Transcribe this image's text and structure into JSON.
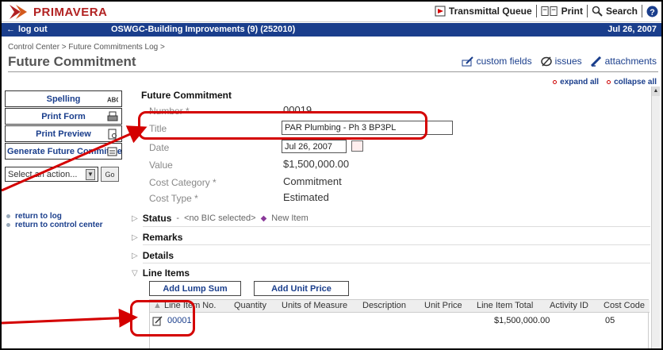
{
  "brand": {
    "name": "PRIMAVERA"
  },
  "toplinks": {
    "transmittal": "Transmittal Queue",
    "print": "Print",
    "search": "Search",
    "help": "?"
  },
  "navbar": {
    "logout": "log out",
    "project": "OSWGC-Building Improvements (9) (252010)",
    "date": "Jul 26, 2007"
  },
  "header": {
    "breadcrumb": "Control Center > Future Commitments Log >",
    "title": "Future Commitment",
    "actions": {
      "custom_fields": "custom fields",
      "issues": "issues",
      "attachments": "attachments"
    },
    "expand_all": "expand all",
    "collapse_all": "collapse all"
  },
  "sidebar": {
    "buttons": [
      "Spelling",
      "Print Form",
      "Print Preview",
      "Generate Future Commitme"
    ],
    "select_placeholder": "Select an action...",
    "go": "Go",
    "links": [
      "return to log",
      "return to control center"
    ]
  },
  "form": {
    "heading": "Future Commitment",
    "labels": {
      "number": "Number *",
      "title": "Title",
      "date": "Date",
      "value": "Value",
      "cost_category": "Cost Category *",
      "cost_type": "Cost Type *"
    },
    "values": {
      "number": "00019",
      "title": "PAR Plumbing - Ph 3 BP3PL",
      "date": "Jul 26, 2007",
      "value": "$1,500,000.00",
      "cost_category": "Commitment",
      "cost_type": "Estimated"
    }
  },
  "sections": {
    "status": "Status",
    "status_bic": "<no BIC selected>",
    "status_item": "New Item",
    "remarks": "Remarks",
    "details": "Details",
    "line_items": "Line Items"
  },
  "line_items": {
    "add_lump_sum": "Add Lump Sum",
    "add_unit_price": "Add Unit Price",
    "columns": [
      "Line Item No.",
      "Quantity",
      "Units of Measure",
      "Description",
      "Unit Price",
      "Line Item Total",
      "Activity ID",
      "Cost Code"
    ],
    "rows": [
      {
        "line_no": "00001",
        "quantity": "",
        "uom": "",
        "description": "",
        "unit_price": "",
        "total": "$1,500,000.00",
        "activity": "",
        "cost_code": "05"
      }
    ]
  },
  "colors": {
    "nav_blue": "#1a3e8c",
    "brand_red": "#b22222",
    "callout_red": "#d40000"
  }
}
